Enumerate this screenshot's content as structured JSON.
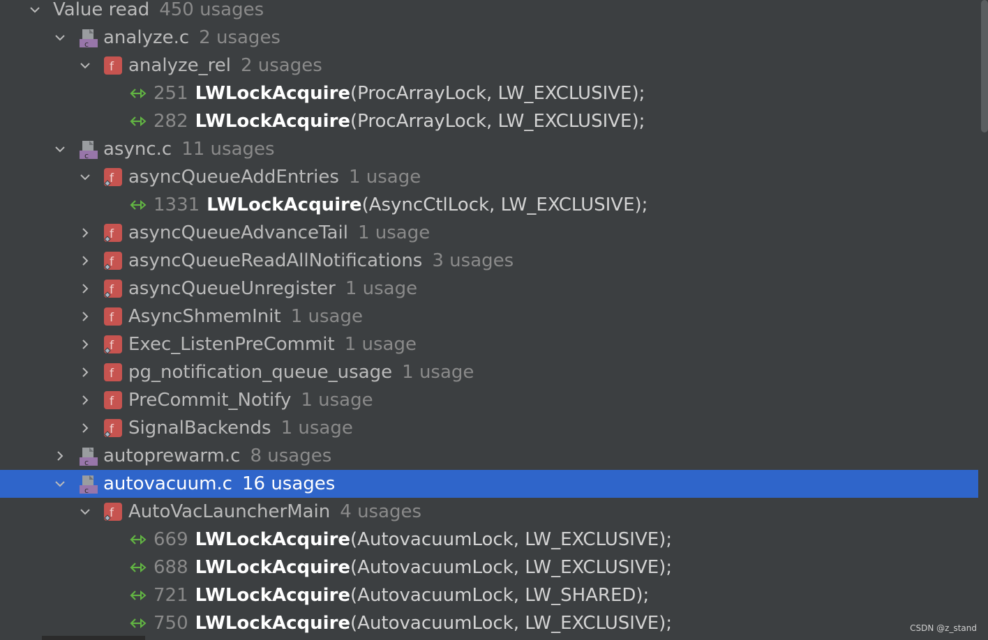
{
  "tree": {
    "root": {
      "label": "Value read",
      "count": "450 usages"
    },
    "files": [
      {
        "name": "analyze.c",
        "count": "2 usages",
        "expanded": true,
        "functions": [
          {
            "name": "analyze_rel",
            "count": "2 usages",
            "expanded": true,
            "local": false,
            "usages": [
              {
                "line": "251",
                "fn": "LWLockAcquire",
                "args": "(ProcArrayLock, LW_EXCLUSIVE);"
              },
              {
                "line": "282",
                "fn": "LWLockAcquire",
                "args": "(ProcArrayLock, LW_EXCLUSIVE);"
              }
            ]
          }
        ]
      },
      {
        "name": "async.c",
        "count": "11 usages",
        "expanded": true,
        "functions": [
          {
            "name": "asyncQueueAddEntries",
            "count": "1 usage",
            "expanded": true,
            "local": true,
            "usages": [
              {
                "line": "1331",
                "fn": "LWLockAcquire",
                "args": "(AsyncCtlLock, LW_EXCLUSIVE);"
              }
            ]
          },
          {
            "name": "asyncQueueAdvanceTail",
            "count": "1 usage",
            "expanded": false,
            "local": true,
            "usages": []
          },
          {
            "name": "asyncQueueReadAllNotifications",
            "count": "3 usages",
            "expanded": false,
            "local": true,
            "usages": []
          },
          {
            "name": "asyncQueueUnregister",
            "count": "1 usage",
            "expanded": false,
            "local": true,
            "usages": []
          },
          {
            "name": "AsyncShmemInit",
            "count": "1 usage",
            "expanded": false,
            "local": false,
            "usages": []
          },
          {
            "name": "Exec_ListenPreCommit",
            "count": "1 usage",
            "expanded": false,
            "local": true,
            "usages": []
          },
          {
            "name": "pg_notification_queue_usage",
            "count": "1 usage",
            "expanded": false,
            "local": false,
            "usages": []
          },
          {
            "name": "PreCommit_Notify",
            "count": "1 usage",
            "expanded": false,
            "local": false,
            "usages": []
          },
          {
            "name": "SignalBackends",
            "count": "1 usage",
            "expanded": false,
            "local": true,
            "usages": []
          }
        ]
      },
      {
        "name": "autoprewarm.c",
        "count": "8 usages",
        "expanded": false,
        "functions": []
      },
      {
        "name": "autovacuum.c",
        "count": "16 usages",
        "expanded": true,
        "selected": true,
        "functions": [
          {
            "name": "AutoVacLauncherMain",
            "count": "4 usages",
            "expanded": true,
            "local": true,
            "usages": [
              {
                "line": "669",
                "fn": "LWLockAcquire",
                "args": "(AutovacuumLock, LW_EXCLUSIVE);"
              },
              {
                "line": "688",
                "fn": "LWLockAcquire",
                "args": "(AutovacuumLock, LW_EXCLUSIVE);"
              },
              {
                "line": "721",
                "fn": "LWLockAcquire",
                "args": "(AutovacuumLock, LW_SHARED);"
              },
              {
                "line": "750",
                "fn": "LWLockAcquire",
                "args": "(AutovacuumLock, LW_EXCLUSIVE);"
              }
            ]
          }
        ]
      }
    ]
  },
  "colors": {
    "background": "#3c3f41",
    "selection": "#2f65ca",
    "function_icon": "#c75450",
    "file_icon": "#9876aa",
    "usage_arrow": "#62b543"
  },
  "icons": {
    "expanded": "chevron-down-icon",
    "collapsed": "chevron-right-icon",
    "file": "c-file-icon",
    "function": "function-icon",
    "usage": "value-read-icon"
  },
  "watermark": "CSDN @z_stand"
}
